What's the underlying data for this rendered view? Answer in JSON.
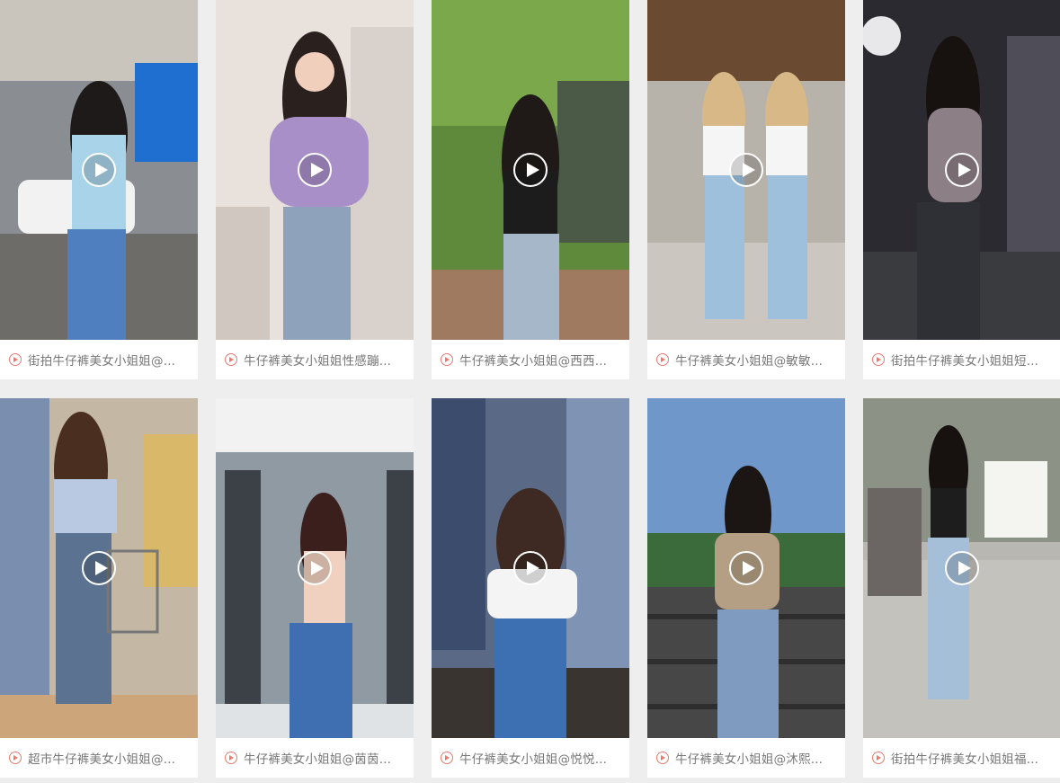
{
  "colors": {
    "page_bg": "#eeeeef",
    "card_bg": "#ffffff",
    "caption_text": "#777777",
    "play_icon_accent": "#e87a6e"
  },
  "videos": [
    {
      "title": "街拍牛仔裤美女小姐姐@...",
      "icon": "play-circle-icon"
    },
    {
      "title": "牛仔裤美女小姐姐性感蹦...",
      "icon": "play-circle-icon"
    },
    {
      "title": "牛仔裤美女小姐姐@西西...",
      "icon": "play-circle-icon"
    },
    {
      "title": "牛仔裤美女小姐姐@敏敏...",
      "icon": "play-circle-icon"
    },
    {
      "title": "街拍牛仔裤美女小姐姐短...",
      "icon": "play-circle-icon"
    },
    {
      "title": "超市牛仔裤美女小姐姐@...",
      "icon": "play-circle-icon"
    },
    {
      "title": "牛仔裤美女小姐姐@茵茵...",
      "icon": "play-circle-icon"
    },
    {
      "title": "牛仔裤美女小姐姐@悦悦...",
      "icon": "play-circle-icon"
    },
    {
      "title": "牛仔裤美女小姐姐@沐熙...",
      "icon": "play-circle-icon"
    },
    {
      "title": "街拍牛仔裤美女小姐姐福...",
      "icon": "play-circle-icon"
    }
  ]
}
